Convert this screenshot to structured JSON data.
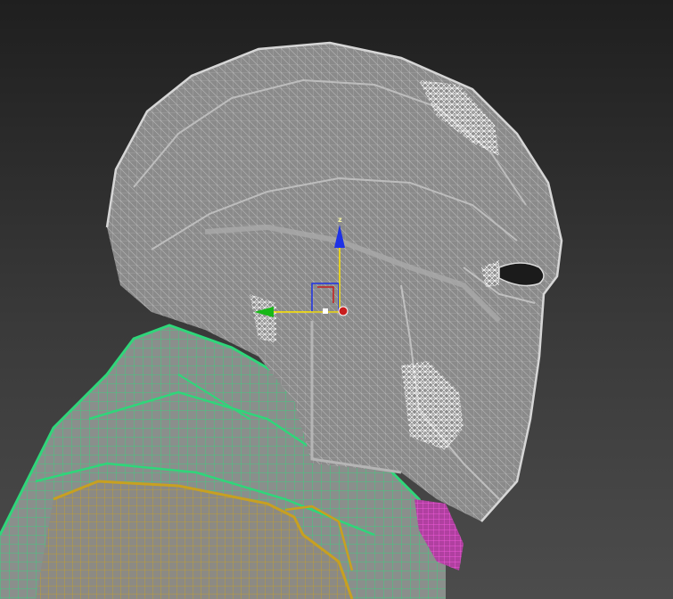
{
  "viewport": {
    "background_top": "#1f1f1f",
    "background_bottom": "#4c4c4c"
  },
  "mesh_colors": {
    "helmet_fill": "#8a8a8a",
    "helmet_wire": "#c9c9c9",
    "helmet_wire_bright": "#f2f2f2",
    "collar_wire": "#2fd67a",
    "collar_fill": "#8a8f8c",
    "shoulder_wire": "#c8a020",
    "shoulder_fill": "#8c8a84",
    "neck_wire": "#e020c8"
  },
  "gizmo": {
    "type": "move-gizmo",
    "z_label": "z",
    "x_color": "#c81e1e",
    "y_color": "#18b818",
    "z_color": "#1e32e6",
    "plane_color": "#ffe600"
  }
}
